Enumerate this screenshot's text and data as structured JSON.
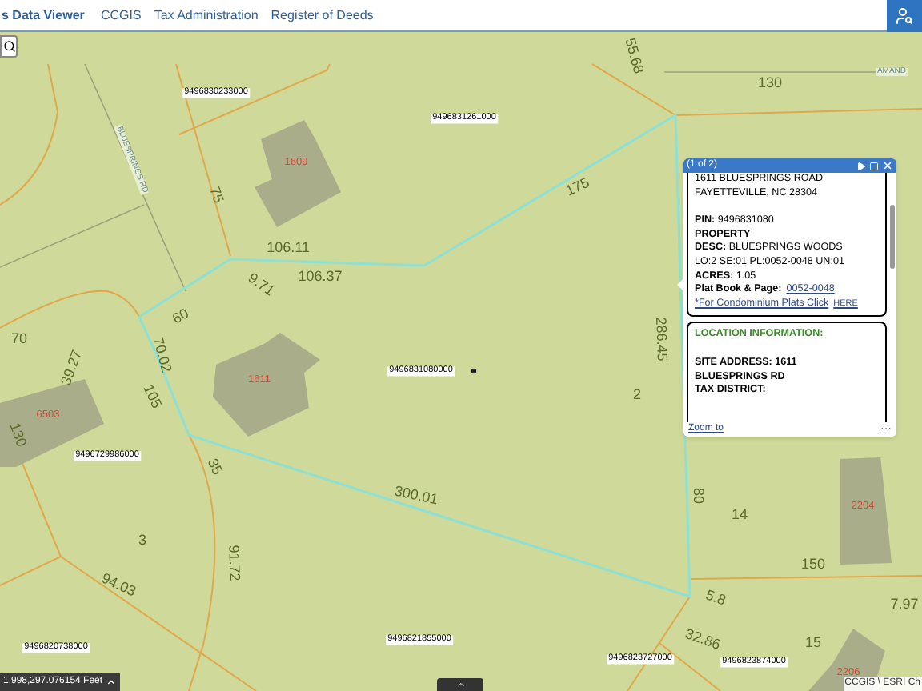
{
  "header": {
    "title": "s Data Viewer",
    "links": [
      "CCGIS",
      "Tax Administration",
      "Register of Deeds"
    ]
  },
  "map": {
    "labels": [
      {
        "kind": "dimension",
        "text": "55.68"
      },
      {
        "kind": "street",
        "text": "AMAND"
      },
      {
        "kind": "dimension",
        "text": "130"
      },
      {
        "kind": "parcel_id",
        "text": "9496830233000"
      },
      {
        "kind": "parcel_id",
        "text": "9496831261000"
      },
      {
        "kind": "house_number",
        "text": "1609"
      },
      {
        "kind": "street",
        "text": "BLUESPRINGS RD"
      },
      {
        "kind": "dimension",
        "text": "75"
      },
      {
        "kind": "dimension",
        "text": "175"
      },
      {
        "kind": "dimension",
        "text": "106.11"
      },
      {
        "kind": "dimension",
        "text": "106.37"
      },
      {
        "kind": "dimension",
        "text": "9.71"
      },
      {
        "kind": "dimension",
        "text": "70"
      },
      {
        "kind": "dimension",
        "text": "60"
      },
      {
        "kind": "dimension",
        "text": "70.02"
      },
      {
        "kind": "house_number",
        "text": "1611"
      },
      {
        "kind": "parcel_id",
        "text": "9496831080000"
      },
      {
        "kind": "dimension",
        "text": "39.27"
      },
      {
        "kind": "dimension",
        "text": "105"
      },
      {
        "kind": "lot_number",
        "text": "2"
      },
      {
        "kind": "dimension",
        "text": "286.45"
      },
      {
        "kind": "house_number",
        "text": "6503"
      },
      {
        "kind": "dimension",
        "text": "130"
      },
      {
        "kind": "parcel_id",
        "text": "9496729986000"
      },
      {
        "kind": "dimension",
        "text": "35"
      },
      {
        "kind": "dimension",
        "text": "300.01"
      },
      {
        "kind": "dimension",
        "text": "80"
      },
      {
        "kind": "lot_number",
        "text": "14"
      },
      {
        "kind": "house_number",
        "text": "2204"
      },
      {
        "kind": "lot_number",
        "text": "3"
      },
      {
        "kind": "dimension",
        "text": "91.72"
      },
      {
        "kind": "dimension",
        "text": "94.03"
      },
      {
        "kind": "dimension",
        "text": "150"
      },
      {
        "kind": "dimension",
        "text": "5.8"
      },
      {
        "kind": "dimension",
        "text": "7.97"
      },
      {
        "kind": "parcel_id",
        "text": "9496820738000"
      },
      {
        "kind": "parcel_id",
        "text": "9496821855000"
      },
      {
        "kind": "dimension",
        "text": "32.86"
      },
      {
        "kind": "parcel_id",
        "text": "9496823727000"
      },
      {
        "kind": "parcel_id",
        "text": "9496823874000"
      },
      {
        "kind": "lot_number",
        "text": "15"
      },
      {
        "kind": "house_number",
        "text": "2206"
      }
    ],
    "scale": "1,998,297.076154 Feet",
    "attribution": "CCGIS \\ ESRI Ch"
  },
  "popup": {
    "title": "(1 of 2)",
    "sections": [
      {
        "lines": [
          {
            "kind": "text",
            "text": "1611 BLUESPRINGS ROAD"
          },
          {
            "kind": "text",
            "text": "FAYETTEVILLE, NC 28304"
          },
          {
            "kind": "blank"
          },
          {
            "kind": "text",
            "text": "**PIN:** 9496831080"
          },
          {
            "kind": "text",
            "text": "**PROPERTY**"
          },
          {
            "kind": "text",
            "text": "**DESC:** BLUESPRINGS WOODS"
          },
          {
            "kind": "text",
            "text": "LO:2 SE:01 PL:0052-0048 UN:01"
          },
          {
            "kind": "text",
            "text": "**ACRES:** 1.05"
          },
          {
            "kind": "text_link",
            "text": "**Plat Book & Page:**",
            "link": "0052-0048"
          },
          {
            "kind": "links",
            "links": [
              "*For Condominium Plats Click",
              "HERE"
            ]
          }
        ]
      },
      {
        "heading": "LOCATION INFORMATION:",
        "lines": [
          {
            "kind": "blank"
          },
          {
            "kind": "text",
            "text": "**SITE ADDRESS: 1611**"
          },
          {
            "kind": "text",
            "text": "**BLUESPRINGS RD**"
          },
          {
            "kind": "text",
            "text": "**TAX DISTRICT:**"
          }
        ]
      }
    ],
    "zoom_link": "Zoom to",
    "more": "···"
  }
}
